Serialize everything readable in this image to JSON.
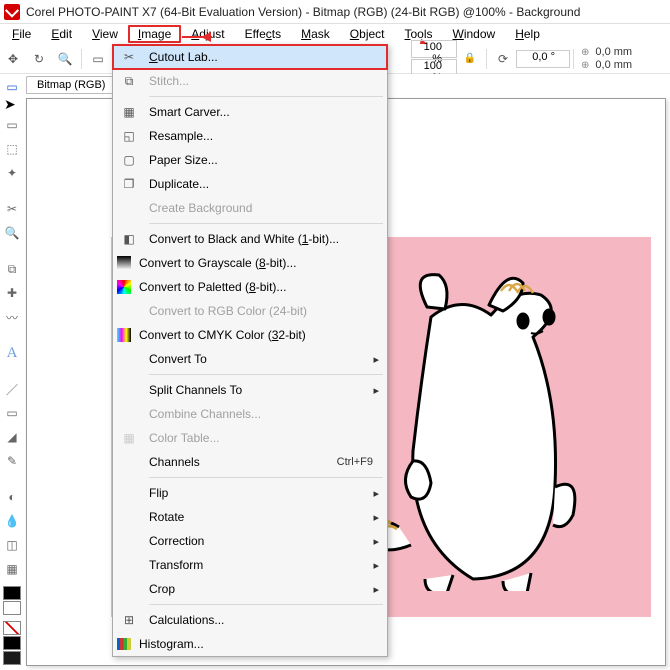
{
  "title": "Corel PHOTO-PAINT X7 (64-Bit Evaluation Version) - Bitmap (RGB) (24-Bit RGB) @100% - Background",
  "menu": {
    "file": "File",
    "edit": "Edit",
    "view": "View",
    "image": "Image",
    "adjust": "Adjust",
    "effects": "Effects",
    "mask": "Mask",
    "object": "Object",
    "tools": "Tools",
    "window": "Window",
    "help": "Help"
  },
  "toolbar": {
    "zoom1": "100 %",
    "zoom2": "100 %",
    "angle": "0,0 °",
    "off1": "0,0 mm",
    "off2": "0,0 mm"
  },
  "doc_tab": "Bitmap (RGB)",
  "image_menu": {
    "cutout": "Cutout Lab...",
    "stitch": "Stitch...",
    "smart": "Smart Carver...",
    "resample": "Resample...",
    "paper": "Paper Size...",
    "duplicate": "Duplicate...",
    "create_bg": "Create Background",
    "bw": "Convert to Black and White (1-bit)...",
    "gray": "Convert to Grayscale (8-bit)...",
    "pal": "Convert to Paletted (8-bit)...",
    "rgb": "Convert to RGB Color (24-bit)",
    "cmyk": "Convert to CMYK Color (32-bit)",
    "convert_to": "Convert To",
    "split": "Split Channels To",
    "combine": "Combine Channels...",
    "ctable": "Color Table...",
    "channels": "Channels",
    "channels_sc": "Ctrl+F9",
    "flip": "Flip",
    "rotate": "Rotate",
    "correction": "Correction",
    "transform": "Transform",
    "crop": "Crop",
    "calc": "Calculations...",
    "hist": "Histogram..."
  }
}
